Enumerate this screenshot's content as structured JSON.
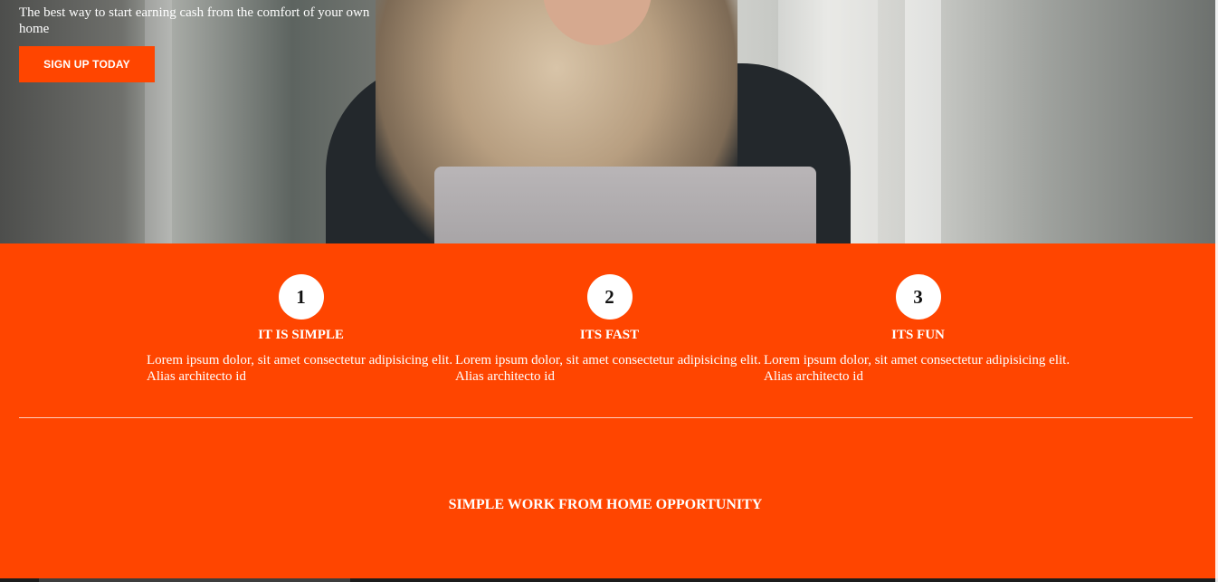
{
  "hero": {
    "tagline": "The best way to start earning cash from the comfort of your own home",
    "signup_label": "SIGN UP TODAY"
  },
  "features": [
    {
      "number": "1",
      "title": "IT IS SIMPLE",
      "text": "Lorem ipsum dolor, sit amet consectetur adipisicing elit. Alias architecto id"
    },
    {
      "number": "2",
      "title": "ITS FAST",
      "text": "Lorem ipsum dolor, sit amet consectetur adipisicing elit. Alias architecto id"
    },
    {
      "number": "3",
      "title": "ITS FUN",
      "text": "Lorem ipsum dolor, sit amet consectetur adipisicing elit. Alias architecto id"
    }
  ],
  "cta": {
    "heading": "SIMPLE WORK FROM HOME OPPORTUNITY"
  },
  "colors": {
    "accent": "#ff4500",
    "text": "#ffffff"
  }
}
